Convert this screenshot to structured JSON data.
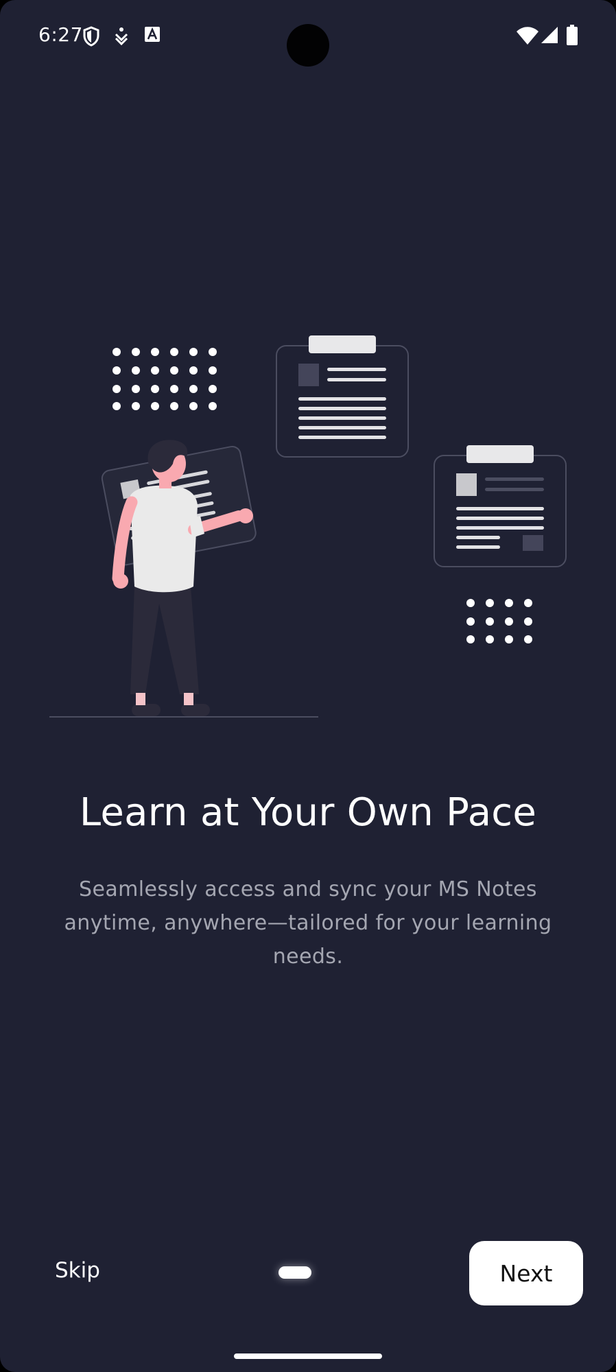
{
  "status_bar": {
    "time": "6:27",
    "icons": [
      "shield-icon",
      "download-icon",
      "font-icon",
      "wifi-icon",
      "signal-icon",
      "battery-icon"
    ]
  },
  "onboarding": {
    "title": "Learn at Your Own Pace",
    "subtitle": "Seamlessly access and sync your MS Notes anytime, anywhere—tailored for your learning needs.",
    "illustration": "person-with-notes-illustration",
    "page_indicator": {
      "current": 1
    }
  },
  "footer": {
    "skip_label": "Skip",
    "next_label": "Next"
  },
  "colors": {
    "background": "#1f2133",
    "text_primary": "#ffffff",
    "text_secondary": "#a4a6b1",
    "button_bg": "#ffffff",
    "accent_skin": "#f9a9b0"
  }
}
